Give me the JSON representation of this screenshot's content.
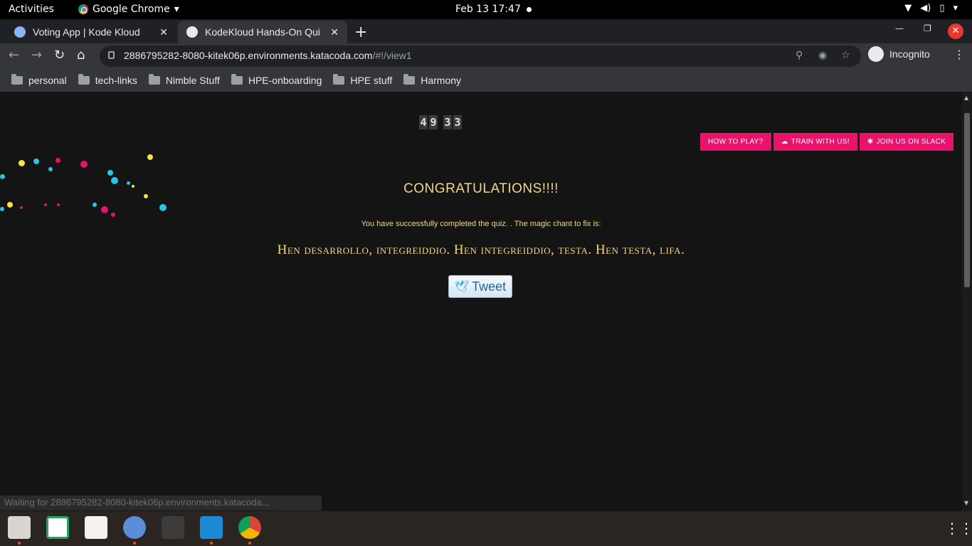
{
  "topbar": {
    "activities": "Activities",
    "app_name": "Google Chrome",
    "clock": "Feb 13  17:47"
  },
  "tabs": [
    {
      "title": "Voting App | Kode Kloud",
      "active": false
    },
    {
      "title": "KodeKloud Hands-On Qui",
      "active": true
    }
  ],
  "omnibox": {
    "host": "2886795282-8080-kitek06p.environments.katacoda.com",
    "path": "/#!/view1"
  },
  "profile": {
    "label": "Incognito"
  },
  "bookmarks": [
    "personal",
    "tech-links",
    "Nimble Stuff",
    "HPE-onboarding",
    "HPE stuff",
    "Harmony"
  ],
  "timer": {
    "digits": [
      "4",
      "9",
      "3",
      "3"
    ]
  },
  "buttons": {
    "how_to_play": "HOW TO PLAY?",
    "train": "TRAIN WITH US!",
    "slack": "JOIN US ON SLACK"
  },
  "result": {
    "heading": "CONGRATULATIONS!!!!",
    "message": "You have successfully completed the quiz. . The magic chant to fix is:",
    "chant": "Hen desarrollo, integreiddio. Hen integreiddio, testa. Hen testa, lifa."
  },
  "tweet": {
    "label": "Tweet"
  },
  "status_bar": "Waiting for 2886795282-8080-kitek06p.environments.katacoda...",
  "colors": {
    "accent_pink": "#e8146b",
    "text_gold": "#f0d58a",
    "page_bg": "#141414"
  },
  "dock": {
    "apps": [
      "files-icon",
      "sheets-icon",
      "text-editor-icon",
      "chromium-icon",
      "terminal-icon",
      "vscode-icon",
      "chrome-icon"
    ]
  }
}
